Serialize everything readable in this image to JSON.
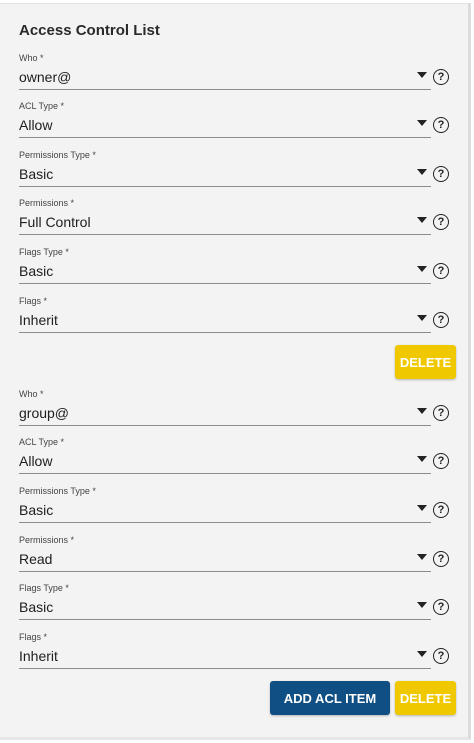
{
  "title": "Access Control List",
  "help_glyph": "?",
  "buttons": {
    "delete_label": "DELETE",
    "add_label": "ADD ACL ITEM"
  },
  "colors": {
    "delete_bg": "#f0c800",
    "add_bg": "#0f4f84",
    "panel_bg": "#f3f3f3"
  },
  "acl_items": [
    {
      "who": {
        "label": "Who *",
        "value": "owner@"
      },
      "acl_type": {
        "label": "ACL Type *",
        "value": "Allow"
      },
      "permissions_type": {
        "label": "Permissions Type *",
        "value": "Basic"
      },
      "permissions": {
        "label": "Permissions *",
        "value": "Full Control"
      },
      "flags_type": {
        "label": "Flags Type *",
        "value": "Basic"
      },
      "flags": {
        "label": "Flags *",
        "value": "Inherit"
      }
    },
    {
      "who": {
        "label": "Who *",
        "value": "group@"
      },
      "acl_type": {
        "label": "ACL Type *",
        "value": "Allow"
      },
      "permissions_type": {
        "label": "Permissions Type *",
        "value": "Basic"
      },
      "permissions": {
        "label": "Permissions *",
        "value": "Read"
      },
      "flags_type": {
        "label": "Flags Type *",
        "value": "Basic"
      },
      "flags": {
        "label": "Flags *",
        "value": "Inherit"
      }
    }
  ]
}
